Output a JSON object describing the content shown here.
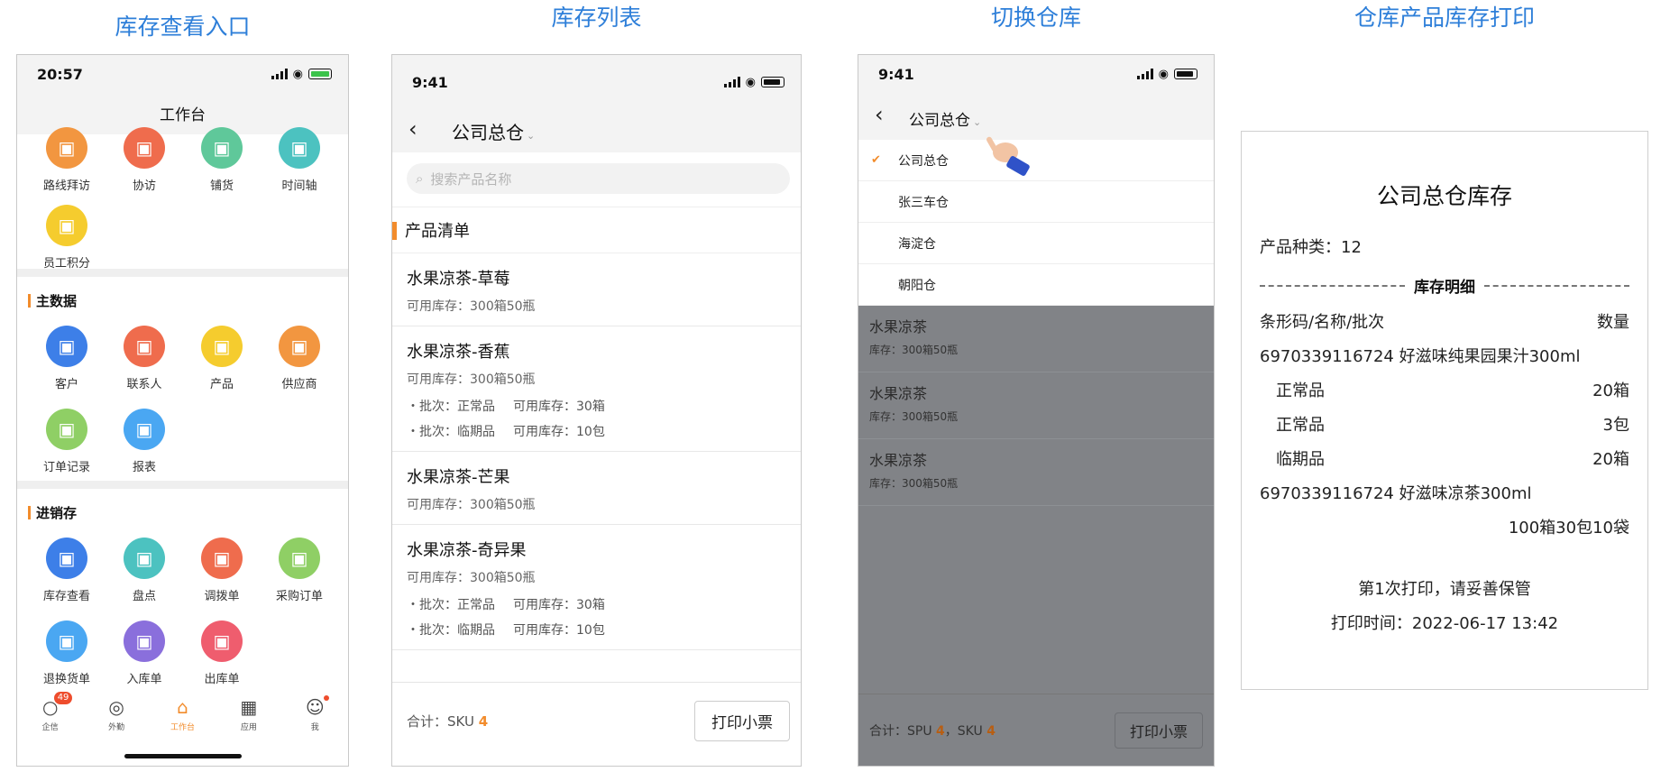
{
  "section_titles": [
    "库存查看入口",
    "库存列表",
    "切换仓库",
    "仓库产品库存打印"
  ],
  "colors": {
    "accent": "#f28c2c",
    "title_blue": "#2e7fd9"
  },
  "phone1": {
    "time": "20:57",
    "title": "工作台",
    "top_row": [
      {
        "label": "路线拜访",
        "icon": "route-icon",
        "color": "#f29640"
      },
      {
        "label": "协访",
        "icon": "users-icon",
        "color": "#ef6c4d"
      },
      {
        "label": "铺货",
        "icon": "store-icon",
        "color": "#5fc89a"
      },
      {
        "label": "时间轴",
        "icon": "timeline-icon",
        "color": "#4cc2c0"
      }
    ],
    "points": {
      "label": "员工积分",
      "icon": "coins-icon",
      "color": "#f5cc2e"
    },
    "section_master": "主数据",
    "master_items": [
      {
        "label": "客户",
        "icon": "building-icon",
        "color": "#3d7fe8"
      },
      {
        "label": "联系人",
        "icon": "contact-icon",
        "color": "#ef6c4d"
      },
      {
        "label": "产品",
        "icon": "box-icon",
        "color": "#f5cc2e"
      },
      {
        "label": "供应商",
        "icon": "supplier-icon",
        "color": "#f29640"
      },
      {
        "label": "订单记录",
        "icon": "clipboard-icon",
        "color": "#8fcf65"
      },
      {
        "label": "报表",
        "icon": "report-icon",
        "color": "#4aa7f2"
      }
    ],
    "section_inventory": "进销存",
    "inventory_items": [
      {
        "label": "库存查看",
        "icon": "warehouse-search-icon",
        "color": "#3d7fe8"
      },
      {
        "label": "盘点",
        "icon": "calculator-icon",
        "color": "#4cc2c0"
      },
      {
        "label": "调拨单",
        "icon": "transfer-icon",
        "color": "#ef6c4d"
      },
      {
        "label": "采购订单",
        "icon": "purchase-icon",
        "color": "#8fcf65"
      },
      {
        "label": "退换货单",
        "icon": "return-icon",
        "color": "#4aa7f2"
      },
      {
        "label": "入库单",
        "icon": "inbound-icon",
        "color": "#8a6fdc"
      },
      {
        "label": "出库单",
        "icon": "outbound-icon",
        "color": "#ef5d6e"
      }
    ],
    "tabs": [
      {
        "label": "企信",
        "icon": "chat-icon",
        "badge": "49"
      },
      {
        "label": "外勤",
        "icon": "location-icon"
      },
      {
        "label": "工作台",
        "icon": "home-icon"
      },
      {
        "label": "应用",
        "icon": "apps-icon"
      },
      {
        "label": "我",
        "icon": "profile-icon"
      }
    ]
  },
  "phone2": {
    "time": "9:41",
    "warehouse": "公司总仓",
    "search_placeholder": "搜索产品名称",
    "list_header": "产品清单",
    "products": [
      {
        "name": "水果凉茶-草莓",
        "stock": "可用库存：300箱50瓶",
        "batches": []
      },
      {
        "name": "水果凉茶-香蕉",
        "stock": "可用库存：300箱50瓶",
        "batches": [
          {
            "batch": "・批次：正常品",
            "avail": "可用库存：30箱"
          },
          {
            "batch": "・批次：临期品",
            "avail": "可用库存：10包"
          }
        ]
      },
      {
        "name": "水果凉茶-芒果",
        "stock": "可用库存：300箱50瓶",
        "batches": []
      },
      {
        "name": "水果凉茶-奇异果",
        "stock": "可用库存：300箱50瓶",
        "batches": [
          {
            "batch": "・批次：正常品",
            "avail": "可用库存：30箱"
          },
          {
            "batch": "・批次：临期品",
            "avail": "可用库存：10包"
          }
        ]
      }
    ],
    "total_label": "合计：SKU",
    "total_sku": "4",
    "print_button": "打印小票"
  },
  "phone3": {
    "time": "9:41",
    "warehouse": "公司总仓",
    "options": [
      "公司总仓",
      "张三车仓",
      "海淀仓",
      "朝阳仓"
    ],
    "selected_index": 0,
    "dim_items": [
      {
        "name": "水果凉茶",
        "stock": "库存：300箱50瓶"
      },
      {
        "name": "水果凉茶",
        "stock": "库存：300箱50瓶"
      },
      {
        "name": "水果凉茶",
        "stock": "库存：300箱50瓶"
      }
    ],
    "total_prefix": "合计：SPU",
    "total_spu": "4",
    "total_mid": "，SKU",
    "total_sku": "4",
    "print_button": "打印小票"
  },
  "receipt": {
    "title": "公司总仓库存",
    "types_label": "产品种类：12",
    "detail_label": "库存明细",
    "col_left": "条形码/名称/批次",
    "col_right": "数量",
    "product1": "6970339116724 好滋味纯果园果汁300ml",
    "p1_rows": [
      {
        "name": "正常品",
        "qty": "20箱"
      },
      {
        "name": "正常品",
        "qty": "3包"
      },
      {
        "name": "临期品",
        "qty": "20箱"
      }
    ],
    "product2": "6970339116724 好滋味凉茶300ml",
    "p2_total": "100箱30包10袋",
    "print_count": "第1次打印，请妥善保管",
    "print_time": "打印时间：2022-06-17 13:42"
  }
}
